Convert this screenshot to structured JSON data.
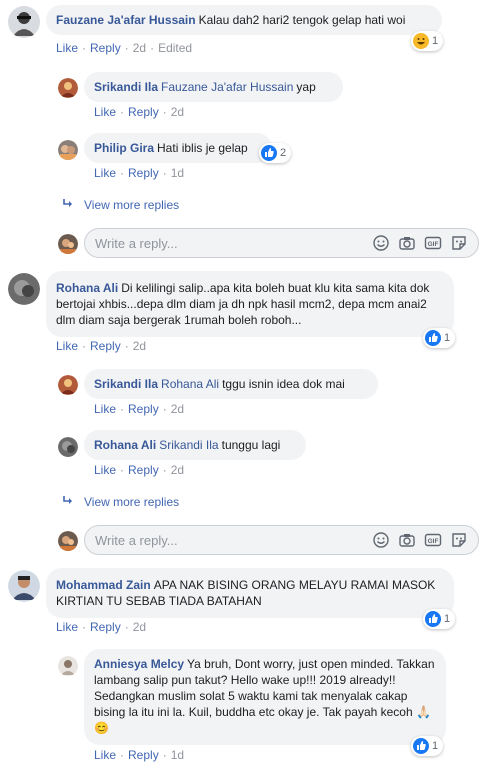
{
  "comments": [
    {
      "name": "Fauzane Ja'afar Hussain",
      "text": "Kalau dah2 hari2 tengok gelap hati woi",
      "like": "Like",
      "reply": "Reply",
      "time": "2d",
      "edited": "Edited",
      "reaction": {
        "type": "haha",
        "count": "1"
      }
    },
    {
      "name": "Srikandi Ila",
      "tag": "Fauzane Ja'afar Hussain",
      "text": "yap",
      "like": "Like",
      "reply": "Reply",
      "time": "2d"
    },
    {
      "name": "Philip Gira",
      "text": "Hati iblis je gelap",
      "like": "Like",
      "reply": "Reply",
      "time": "1d",
      "reaction": {
        "type": "like",
        "count": "2"
      }
    },
    {
      "name": "Rohana Ali",
      "text": "Di kelilingi salip..apa kita boleh buat klu kita sama kita dok bertojai xhbis...depa dlm diam ja dh npk hasil mcm2, depa mcm anai2 dlm diam saja bergerak 1rumah boleh roboh...",
      "like": "Like",
      "reply": "Reply",
      "time": "2d",
      "reaction": {
        "type": "like",
        "count": "1"
      }
    },
    {
      "name": "Srikandi Ila",
      "tag": "Rohana Ali",
      "text": "tggu isnin idea dok mai",
      "like": "Like",
      "reply": "Reply",
      "time": "2d"
    },
    {
      "name": "Rohana Ali",
      "tag": "Srikandi Ila",
      "text": "tunggu lagi",
      "like": "Like",
      "reply": "Reply",
      "time": "2d"
    },
    {
      "name": "Mohammad Zain",
      "text": "APA NAK BISING ORANG MELAYU RAMAI MASOK KIRTIAN TU SEBAB TIADA BATAHAN",
      "like": "Like",
      "reply": "Reply",
      "time": "2d",
      "reaction": {
        "type": "like",
        "count": "1"
      }
    },
    {
      "name": "Anniesya Melcy",
      "text": "Ya bruh, Dont worry, just open minded. Takkan lambang salip pun takut? Hello wake up!!! 2019 already!! Sedangkan muslim solat 5 waktu kami tak menyalak cakap bising la itu ini la. Kuil, buddha etc okay je. Tak payah kecoh 🙏🏻😊",
      "like": "Like",
      "reply": "Reply",
      "time": "1d",
      "reaction": {
        "type": "like",
        "count": "1"
      }
    }
  ],
  "view_more_replies": "View more replies",
  "reply_placeholder": "Write a reply...",
  "colors": {
    "link": "#385898",
    "action": "#4267b2",
    "like_blue": "#1877f2",
    "haha_yellow": "#f7b928"
  }
}
